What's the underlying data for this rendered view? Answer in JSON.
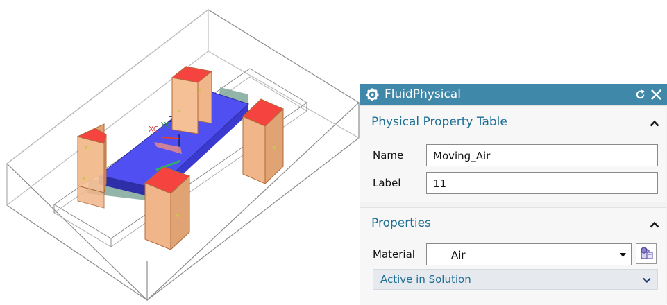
{
  "dialog": {
    "title": "FluidPhysical",
    "icon": "gear-icon",
    "title_bar_color": "#3f88a9",
    "accent_color": "#1f6f95"
  },
  "physical_property_table": {
    "header": "Physical Property Table",
    "name_label": "Name",
    "name_value": "Moving_Air",
    "label_label": "Label",
    "label_value": "11"
  },
  "properties": {
    "header": "Properties",
    "material_label": "Material",
    "material_value": "Air",
    "active_in_solution": "Active in Solution"
  },
  "viewport": {
    "triad": {
      "xc": "XC",
      "yc": "YC",
      "zc": "ZC"
    },
    "colors": {
      "plate": "#4f4ff2",
      "pillar": "#f0b689",
      "pillar_top": "#f5443f",
      "mesh": "#7fa79a"
    }
  }
}
